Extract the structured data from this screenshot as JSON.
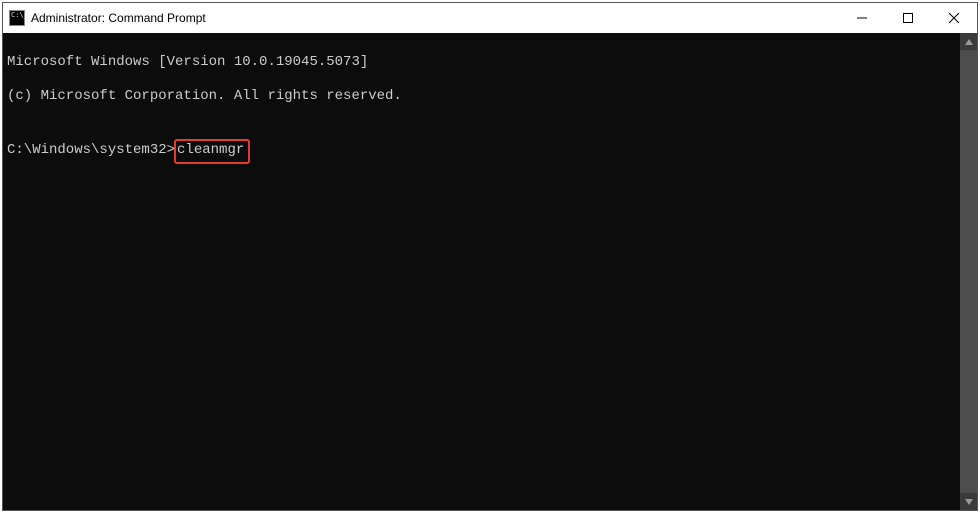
{
  "window": {
    "title": "Administrator: Command Prompt"
  },
  "terminal": {
    "line1": "Microsoft Windows [Version 10.0.19045.5073]",
    "line2": "(c) Microsoft Corporation. All rights reserved.",
    "blank": "",
    "prompt": "C:\\Windows\\system32>",
    "command": "cleanmgr"
  }
}
